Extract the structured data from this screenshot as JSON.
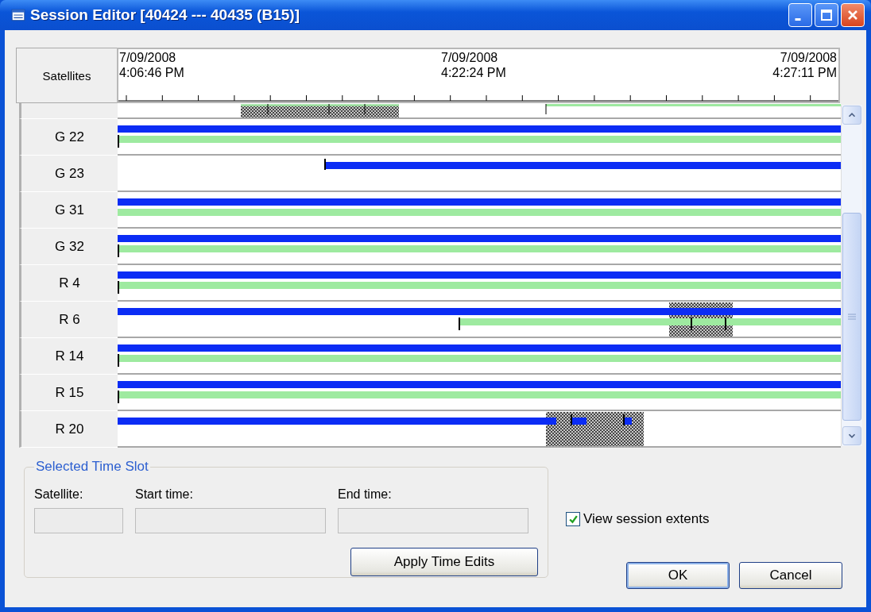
{
  "window": {
    "title": "Session Editor [40424 --- 40435 (B15)]"
  },
  "grid": {
    "header_label": "Satellites",
    "time_labels": [
      {
        "date": "7/09/2008",
        "time": "4:06:46 PM",
        "kind": "left"
      },
      {
        "date": "7/09/2008",
        "time": "4:22:24 PM",
        "kind": "center"
      },
      {
        "date": "7/09/2008",
        "time": "4:27:11 PM",
        "kind": "right"
      }
    ],
    "rows": [
      {
        "label": "G 22"
      },
      {
        "label": "G 23"
      },
      {
        "label": "G 31"
      },
      {
        "label": "G 32"
      },
      {
        "label": "R 4"
      },
      {
        "label": "R 6"
      },
      {
        "label": "R 14"
      },
      {
        "label": "R 15"
      },
      {
        "label": "R 20"
      }
    ]
  },
  "time_slot": {
    "title": "Selected Time Slot",
    "fields": [
      {
        "label": "Satellite:"
      },
      {
        "label": "Start time:"
      },
      {
        "label": "End time:"
      }
    ],
    "apply_button": "Apply Time Edits"
  },
  "view_extents": {
    "label": "View session extents",
    "checked": true
  },
  "buttons": [
    "OK",
    "Cancel"
  ]
}
